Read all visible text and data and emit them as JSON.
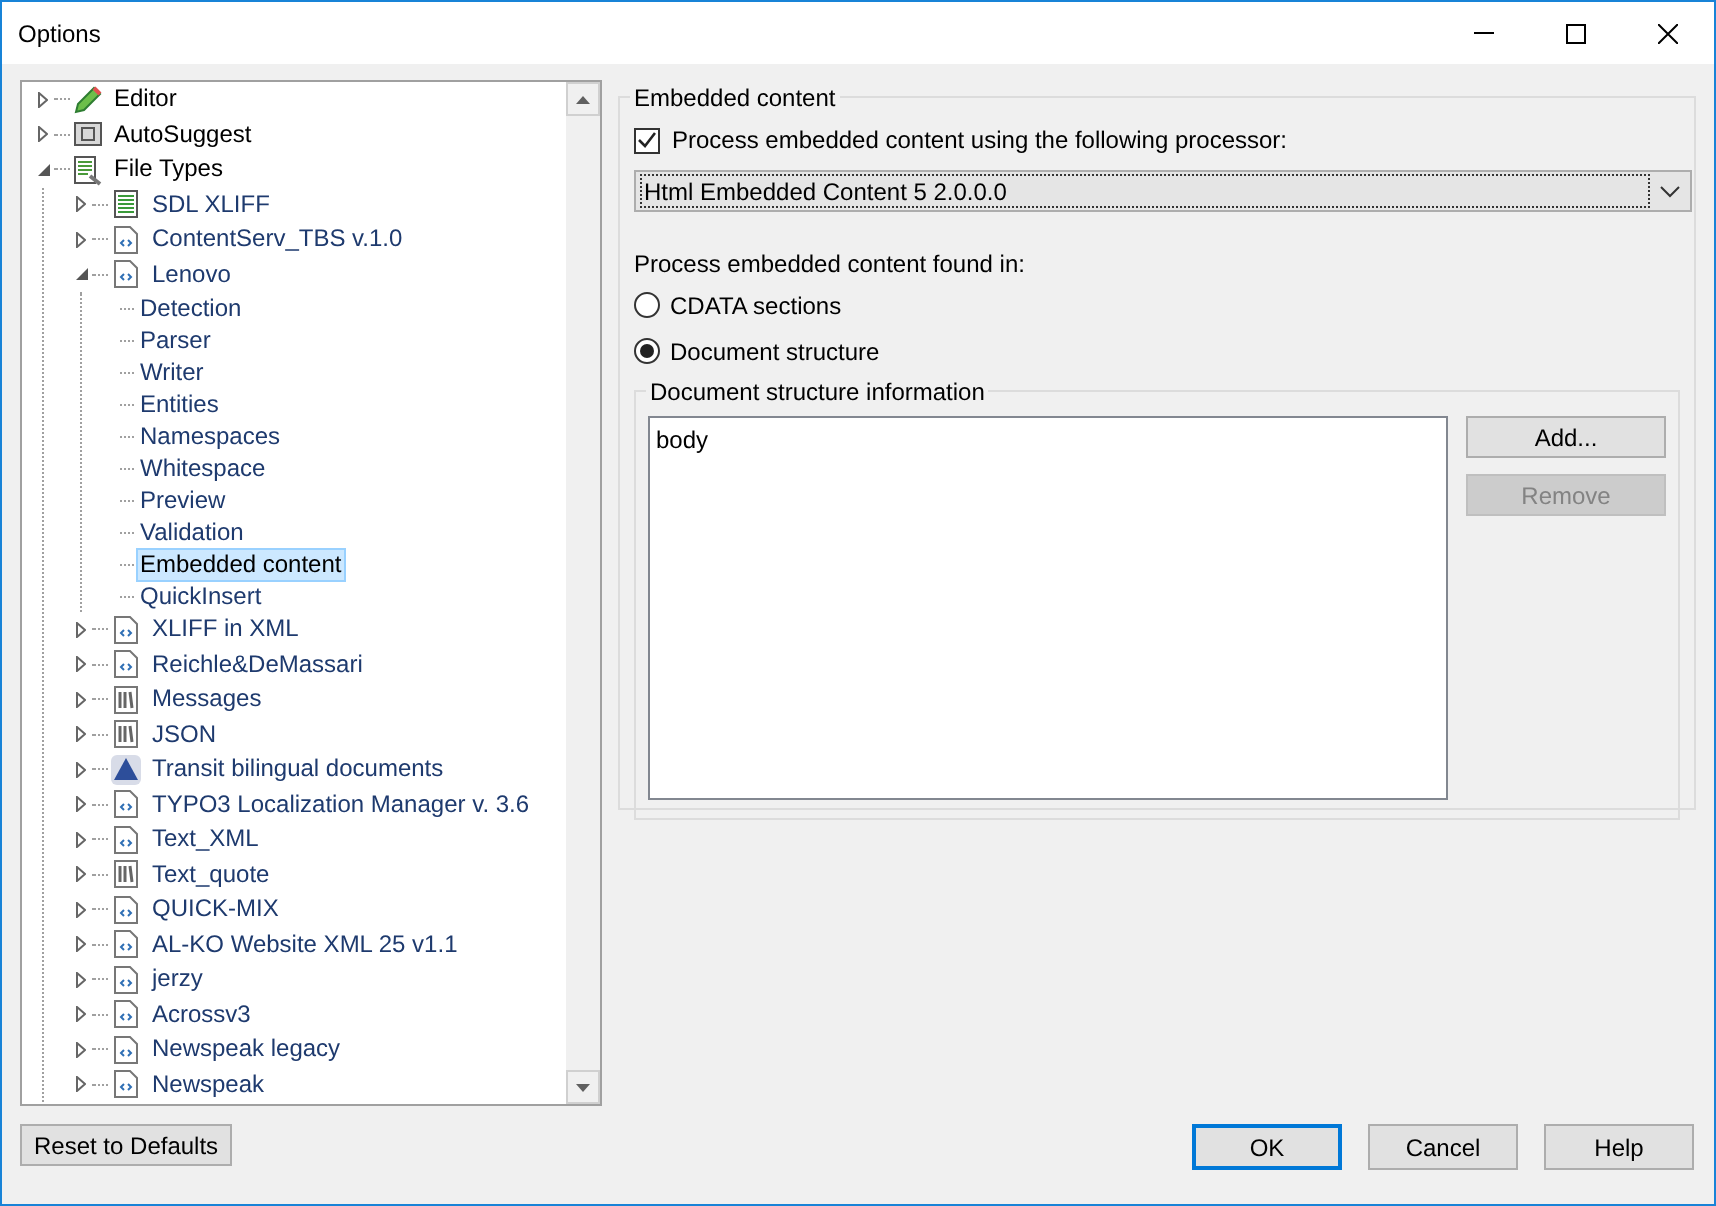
{
  "window": {
    "title": "Options"
  },
  "tree": [
    {
      "label": "Editor",
      "kind": "pencil",
      "expanded": false,
      "selected": false
    },
    {
      "label": "AutoSuggest",
      "kind": "suggest",
      "expanded": false,
      "selected": false
    },
    {
      "label": "File Types",
      "kind": "filetypes",
      "expanded": true,
      "selected": false,
      "children": [
        {
          "label": "SDL XLIFF",
          "kind": "xliff",
          "expanded": false,
          "selected": false
        },
        {
          "label": "ContentServ_TBS v.1.0",
          "kind": "xml",
          "expanded": false,
          "selected": false
        },
        {
          "label": "Lenovo",
          "kind": "xml",
          "expanded": true,
          "selected": false,
          "children": [
            {
              "label": "Detection",
              "selected": false
            },
            {
              "label": "Parser",
              "selected": false
            },
            {
              "label": "Writer",
              "selected": false
            },
            {
              "label": "Entities",
              "selected": false
            },
            {
              "label": "Namespaces",
              "selected": false
            },
            {
              "label": "Whitespace",
              "selected": false
            },
            {
              "label": "Preview",
              "selected": false
            },
            {
              "label": "Validation",
              "selected": false
            },
            {
              "label": "Embedded content",
              "selected": true
            },
            {
              "label": "QuickInsert",
              "selected": false
            }
          ]
        },
        {
          "label": "XLIFF in XML",
          "kind": "xml",
          "expanded": false,
          "selected": false
        },
        {
          "label": "Reichle&DeMassari",
          "kind": "xml",
          "expanded": false,
          "selected": false
        },
        {
          "label": "Messages",
          "kind": "text",
          "expanded": false,
          "selected": false
        },
        {
          "label": "JSON",
          "kind": "text",
          "expanded": false,
          "selected": false
        },
        {
          "label": "Transit bilingual documents",
          "kind": "transit",
          "expanded": false,
          "selected": false
        },
        {
          "label": "TYPO3 Localization Manager v. 3.6",
          "kind": "xml",
          "expanded": false,
          "selected": false
        },
        {
          "label": "Text_XML",
          "kind": "xml",
          "expanded": false,
          "selected": false
        },
        {
          "label": "Text_quote",
          "kind": "text",
          "expanded": false,
          "selected": false
        },
        {
          "label": "QUICK-MIX",
          "kind": "xml",
          "expanded": false,
          "selected": false
        },
        {
          "label": "AL-KO Website XML 25 v1.1",
          "kind": "xml",
          "expanded": false,
          "selected": false
        },
        {
          "label": "jerzy",
          "kind": "xml",
          "expanded": false,
          "selected": false
        },
        {
          "label": "Acrossv3",
          "kind": "xml",
          "expanded": false,
          "selected": false
        },
        {
          "label": "Newspeak legacy",
          "kind": "xml",
          "expanded": false,
          "selected": false
        },
        {
          "label": "Newspeak",
          "kind": "xml",
          "expanded": false,
          "selected": false
        }
      ]
    }
  ],
  "group": {
    "title": "Embedded content",
    "checkbox": {
      "label": "Process embedded content using the following processor:",
      "checked": true
    },
    "processor": {
      "value": "Html Embedded Content 5 2.0.0.0"
    },
    "found_in_label": "Process embedded content found in:",
    "radios": [
      {
        "label": "CDATA sections",
        "selected": false
      },
      {
        "label": "Document structure",
        "selected": true
      }
    ],
    "structure": {
      "title": "Document structure information",
      "items": [
        "body"
      ],
      "buttons": [
        {
          "label": "Add...",
          "disabled": false
        },
        {
          "label": "Remove",
          "disabled": true
        }
      ]
    }
  },
  "footer": {
    "reset": {
      "label": "Reset to Defaults"
    },
    "buttons": [
      {
        "label": "OK",
        "default": true
      },
      {
        "label": "Cancel",
        "default": false
      },
      {
        "label": "Help",
        "default": false
      }
    ]
  }
}
